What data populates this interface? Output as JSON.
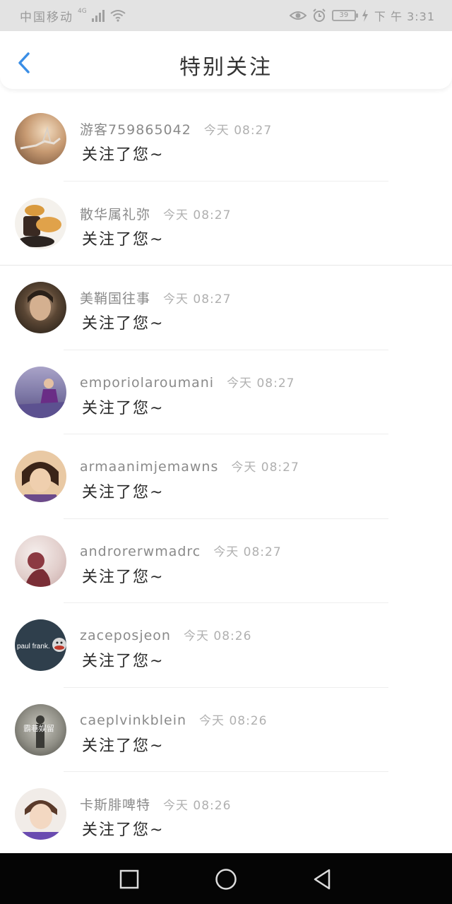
{
  "status_bar": {
    "carrier": "中国移动",
    "network": "4G",
    "battery": "39",
    "time": "下 午 3:31",
    "icons": [
      "signal-icon",
      "wifi-icon",
      "eye-icon",
      "alarm-icon",
      "battery-icon",
      "charging-icon"
    ]
  },
  "header": {
    "title": "特别关注",
    "back_icon": "chevron-left-icon"
  },
  "accent_color": "#3a8ee6",
  "items": [
    {
      "name": "游客759865042",
      "time": "今天 08:27",
      "action": "关注了您~",
      "avatar_colors": [
        "#e9d3b1",
        "#7b5a3f"
      ]
    },
    {
      "name": "散华属礼弥",
      "time": "今天 08:27",
      "action": "关注了您~",
      "avatar_colors": [
        "#f3f0ea",
        "#d6903a"
      ]
    },
    {
      "name": "美鞘国往事",
      "time": "今天 08:27",
      "action": "关注了您~",
      "avatar_colors": [
        "#4b3c2a",
        "#1f1a14"
      ]
    },
    {
      "name": "emporiolaroumani",
      "time": "今天 08:27",
      "action": "关注了您~",
      "avatar_colors": [
        "#8b84b0",
        "#5a2f6a"
      ]
    },
    {
      "name": "armaanimjemawns",
      "time": "今天 08:27",
      "action": "关注了您~",
      "avatar_colors": [
        "#e6c0a0",
        "#7a3b2a"
      ]
    },
    {
      "name": "androrerwmadrc",
      "time": "今天 08:27",
      "action": "关注了您~",
      "avatar_colors": [
        "#efe8e6",
        "#8a3a3e"
      ]
    },
    {
      "name": "zaceposjeon",
      "time": "今天 08:26",
      "action": "关注了您~",
      "avatar_colors": [
        "#2f3f4c",
        "#2f3f4c"
      ],
      "avatar_text": "paul frank."
    },
    {
      "name": "caeplvinkblein",
      "time": "今天 08:26",
      "action": "关注了您~",
      "avatar_colors": [
        "#9c9c94",
        "#4a4a44"
      ],
      "avatar_text": "霸巷娱留"
    },
    {
      "name": "卡斯腓啤特",
      "time": "今天 08:26",
      "action": "关注了您~",
      "avatar_colors": [
        "#f1ece8",
        "#6a4bb0"
      ]
    }
  ],
  "nav_bar": {
    "icons": [
      "square-recent-icon",
      "circle-home-icon",
      "triangle-back-icon"
    ]
  }
}
